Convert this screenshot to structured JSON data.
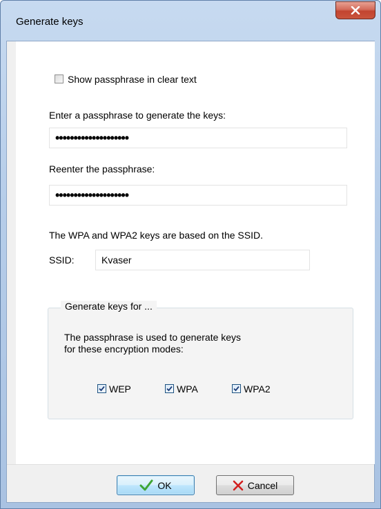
{
  "window": {
    "title": "Generate keys",
    "close_icon": "close-icon"
  },
  "options": {
    "show_clear_text_label": "Show passphrase in clear text",
    "show_clear_text_checked": false
  },
  "passphrase": {
    "label": "Enter a passphrase to generate the keys:",
    "value": "••••••••••••••••••••"
  },
  "reenter": {
    "label": "Reenter the passphrase:",
    "value": "••••••••••••••••••••"
  },
  "ssid": {
    "note": "The WPA and WPA2 keys are based on the SSID.",
    "label": "SSID:",
    "value": "Kvaser"
  },
  "group": {
    "caption": "Generate keys for ...",
    "description_line1": "The passphrase is used to generate keys",
    "description_line2": "for these encryption modes:",
    "modes": [
      {
        "label": "WEP",
        "checked": true
      },
      {
        "label": "WPA",
        "checked": true
      },
      {
        "label": "WPA2",
        "checked": true
      }
    ]
  },
  "buttons": {
    "ok_label": "OK",
    "ok_icon": "checkmark-icon",
    "cancel_label": "Cancel",
    "cancel_icon": "cross-icon"
  },
  "colors": {
    "ok_icon": "#3fa535",
    "cancel_icon": "#d21f1f",
    "close_button": "#c24430"
  }
}
